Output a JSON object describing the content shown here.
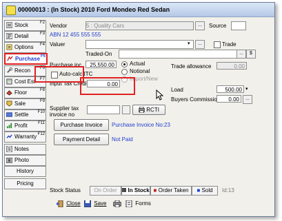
{
  "window": {
    "title": "00000013 : (In Stock) 2010 Ford Mondeo  Red Sedan"
  },
  "colors": {
    "accent": "#1f3fd1",
    "highlight": "#e02020",
    "titlebar": "#c8d8ee"
  },
  "sidebar": {
    "items": [
      {
        "label": "Stock",
        "key": "F2",
        "icon": "stock-icon"
      },
      {
        "label": "Detail",
        "key": "F3",
        "icon": "detail-icon"
      },
      {
        "label": "Options",
        "key": "F4",
        "icon": "options-icon"
      },
      {
        "label": "Purchase",
        "key": "F5",
        "icon": "purchase-icon"
      },
      {
        "label": "Recon",
        "key": "F6",
        "icon": "recon-icon"
      },
      {
        "label": "Cost Est",
        "key": "F7",
        "icon": "cost-est-icon"
      },
      {
        "label": "Floor",
        "key": "F8",
        "icon": "floor-icon"
      },
      {
        "label": "Sale",
        "key": "F9",
        "icon": "sale-icon"
      },
      {
        "label": "Settle",
        "key": "F10",
        "icon": "settle-icon"
      },
      {
        "label": "Profit",
        "key": "F11",
        "icon": "profit-icon"
      },
      {
        "label": "Warranty",
        "key": "F12",
        "icon": "warranty-icon"
      },
      {
        "label": "Notes",
        "key": "",
        "icon": "notes-icon"
      },
      {
        "label": "Photo",
        "key": "",
        "icon": "photo-icon"
      },
      {
        "label": "History",
        "key": "",
        "icon": ""
      },
      {
        "label": "Pricing",
        "key": "",
        "icon": ""
      }
    ]
  },
  "form": {
    "vendor_label": "Vendor",
    "vendor_value": "5 : Quality Cars",
    "source_label": "Source",
    "abn": "ABN 12 455 555 555",
    "valuer_label": "Valuer",
    "trade_label": "Trade",
    "traded_on_label": "Traded-On",
    "purchase_inc_label": "Purchase inc",
    "purchase_inc_value": "25,550.00",
    "actual_label": "Actual",
    "notional_label": "Notional",
    "import_new_label": "Import/New",
    "trade_allowance_label": "Trade allowance",
    "trade_allowance_value": "0.00",
    "auto_calc_itc_label": "Auto-calc ITC",
    "input_tax_credit_label": "Input Tax Credit",
    "input_tax_credit_value": "0.00",
    "load_label": "Load",
    "load_value": "500.00",
    "buyers_commission_label": "Buyers Commission",
    "buyers_commission_value": "0.00",
    "supplier_tax_label": "Supplier tax invoice no",
    "rcti_label": "RCTI",
    "purchase_invoice_button": "Purchase Invoice",
    "purchase_invoice_link": "Purchase Invoice No:23",
    "payment_detail_button": "Payment Detail",
    "payment_status": "Not Paid",
    "ellipsis": "...",
    "dollar": "$"
  },
  "statusbar": {
    "label": "Stock Status",
    "on_order": "On Order",
    "in_stock": "In Stock",
    "order_taken": "Order Taken",
    "sold": "Sold",
    "id": "Id:13"
  },
  "toolbar": {
    "close": "Close",
    "save": "Save",
    "forms": "Forms"
  }
}
